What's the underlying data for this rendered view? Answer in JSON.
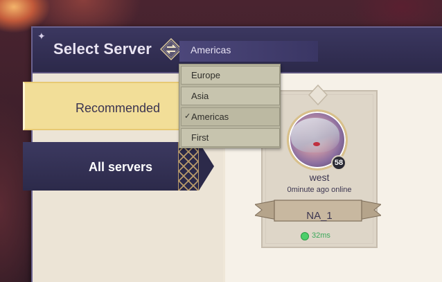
{
  "header": {
    "title": "Select Server",
    "region_selected": "Americas"
  },
  "region_dropdown": {
    "options": [
      {
        "label": "Europe",
        "selected": false
      },
      {
        "label": "Asia",
        "selected": false
      },
      {
        "label": "Americas",
        "selected": true
      },
      {
        "label": "First",
        "selected": false
      }
    ],
    "check_mark": "✓"
  },
  "tabs": {
    "recommended": "Recommended",
    "all_servers": "All servers"
  },
  "server_card": {
    "player_name": "west",
    "last_online": "0minute ago online",
    "level": "58",
    "server_name": "NA_1",
    "ping": "32ms",
    "ping_color": "#4ccf6a"
  },
  "icons": {
    "corner": "corner-star-icon",
    "swap": "swap-region-icon"
  },
  "colors": {
    "header_bg": "#2c294a",
    "recommended_bg": "#f2de98",
    "all_servers_bg": "#2c2a4a",
    "panel_bg": "#efe7d8"
  }
}
